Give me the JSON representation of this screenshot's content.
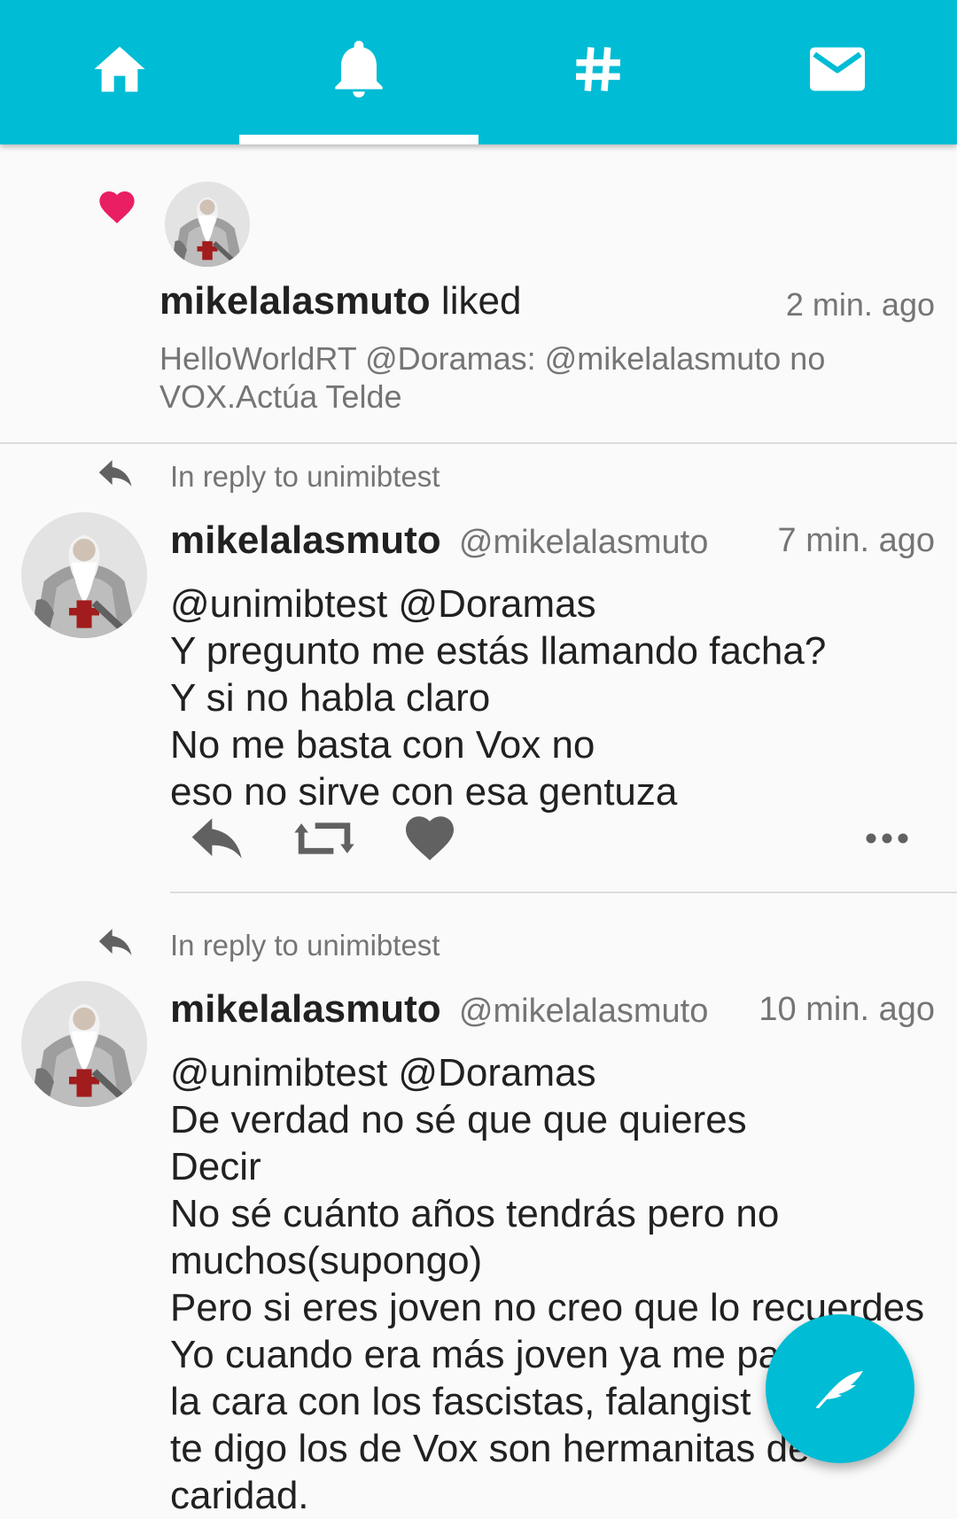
{
  "tabs": [
    {
      "icon": "home-icon",
      "selected": false
    },
    {
      "icon": "bell-icon",
      "selected": true
    },
    {
      "icon": "hashtag-icon",
      "selected": false
    },
    {
      "icon": "mail-icon",
      "selected": false
    }
  ],
  "colors": {
    "accent": "#00bcd4",
    "heart": "#e91e63",
    "text_primary": "#212121",
    "text_secondary": "#757575"
  },
  "notification": {
    "icon": "heart-icon",
    "username": "mikelalasmuto",
    "action": "liked",
    "time": "2 min. ago",
    "text": "HelloWorldRT @Doramas: @mikelalasmuto no VOX.Actúa Telde"
  },
  "tweets": [
    {
      "reply_label": "In reply to unimibtest",
      "name": "mikelalasmuto",
      "handle": "@mikelalasmuto",
      "time": "7 min. ago",
      "lines": [
        "@unimibtest @Doramas",
        "Y pregunto me estás llamando facha?",
        "Y si no habla claro",
        "No me basta con Vox no",
        "eso no sirve con esa gentuza"
      ],
      "actions": [
        "reply-icon",
        "retweet-icon",
        "like-icon",
        "more-icon"
      ]
    },
    {
      "reply_label": "In reply to unimibtest",
      "name": "mikelalasmuto",
      "handle": "@mikelalasmuto",
      "time": "10 min. ago",
      "lines": [
        "@unimibtest @Doramas",
        "De verdad no sé que que quieres",
        "Decir",
        "No sé cuánto años tendrás pero no",
        "muchos(supongo)",
        "Pero si eres joven no creo que lo recuerdes",
        "Yo cuando era más joven ya me pa",
        "la cara con los fascistas, falangist",
        "te digo los de Vox son hermanitas de",
        "caridad."
      ]
    }
  ],
  "fab": {
    "icon": "quill-icon"
  }
}
